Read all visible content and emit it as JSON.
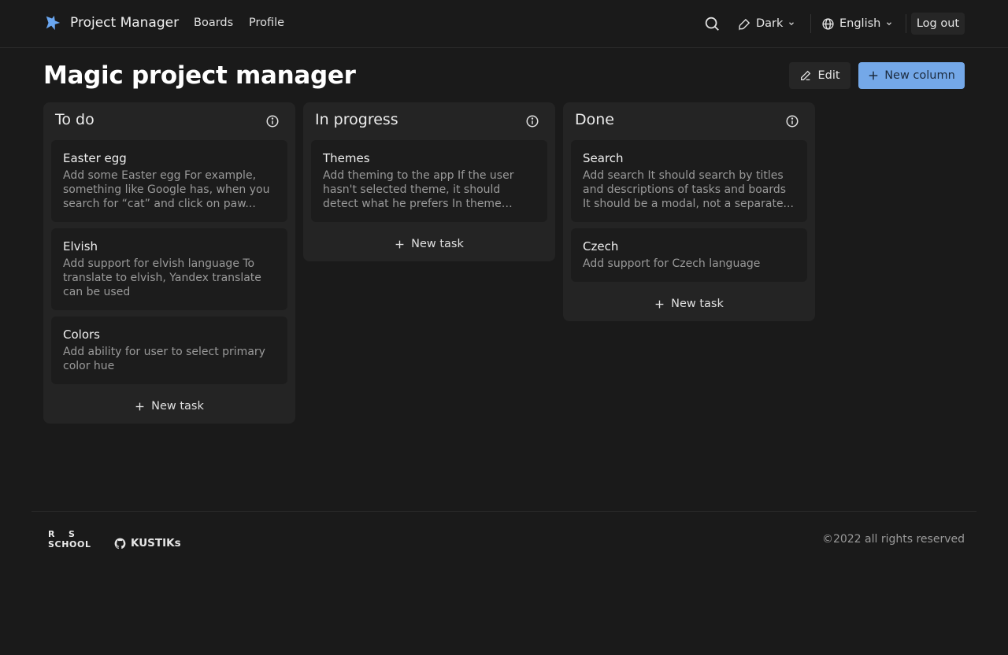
{
  "header": {
    "app_title": "Project Manager",
    "nav": [
      "Boards",
      "Profile"
    ],
    "theme_label": "Dark",
    "language_label": "English",
    "logout_label": "Log out"
  },
  "board": {
    "title": "Magic project manager",
    "edit_label": "Edit",
    "new_column_label": "New column",
    "new_task_label": "New task",
    "columns": [
      {
        "title": "To do",
        "tasks": [
          {
            "title": "Easter egg",
            "description": "Add some Easter egg For example, something like Google has, when you search for “cat” and click on paw..."
          },
          {
            "title": "Elvish",
            "description": "Add support for elvish language To translate to elvish, Yandex translate can be used"
          },
          {
            "title": "Colors",
            "description": "Add ability for user to select primary color hue"
          }
        ]
      },
      {
        "title": "In progress",
        "tasks": [
          {
            "title": "Themes",
            "description": "Add theming to the app If the user hasn't selected theme, it should detect what he prefers In theme select there..."
          }
        ]
      },
      {
        "title": "Done",
        "tasks": [
          {
            "title": "Search",
            "description": "Add search It should search by titles and descriptions of tasks and boards It should be a modal, not a separate..."
          },
          {
            "title": "Czech",
            "description": "Add support for Czech language"
          }
        ]
      }
    ]
  },
  "footer": {
    "rs_logo_text": "RS SCHOOL",
    "github_label": "KUSTIKs",
    "copyright": "©2022 all rights reserved"
  },
  "colors": {
    "background": "#1a1a1a",
    "column_bg": "#242424",
    "task_bg": "#1c1c1c",
    "accent": "#74a8e8",
    "logo": "#6aa6f0"
  },
  "icons": {
    "logo": "star-logo-icon",
    "search": "search-icon",
    "theme": "brush-icon",
    "language": "globe-icon",
    "edit": "pencil-icon",
    "add": "plus-icon",
    "info": "info-icon",
    "github": "github-icon"
  }
}
